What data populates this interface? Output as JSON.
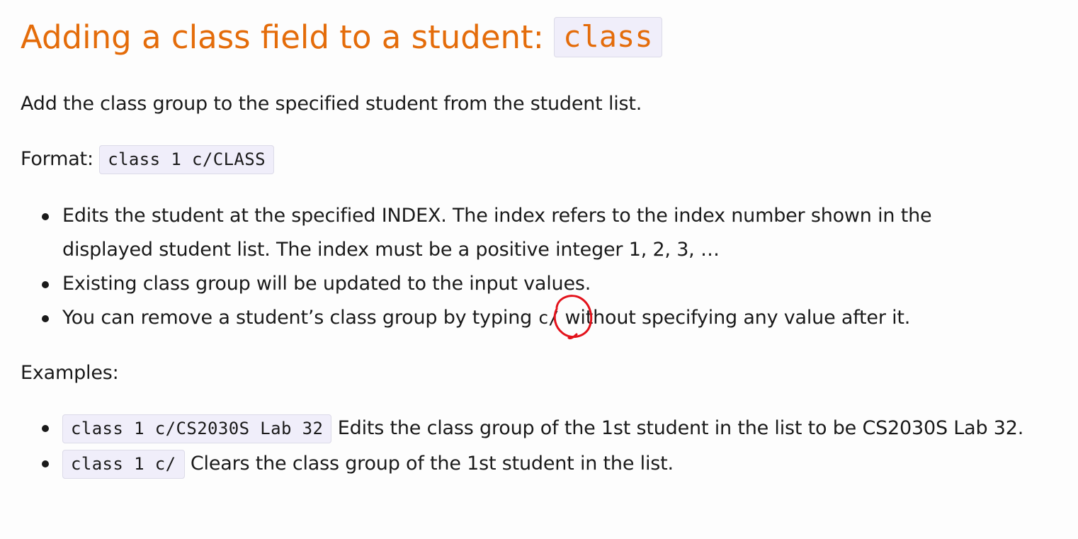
{
  "heading": {
    "text": "Adding a class field to a student: ",
    "code": "class"
  },
  "intro": "Add the class group to the specified student from the student list.",
  "format": {
    "label": "Format: ",
    "code": "class 1 c/CLASS"
  },
  "notes": [
    "Edits the student at the specified INDEX. The index refers to the index number shown in the displayed student list. The index must be a positive integer 1, 2, 3, …",
    "Existing class group will be updated to the input values.",
    {
      "before": "You can remove a student’s class group by typing ",
      "code": "c/",
      "after": " without specifying any value after it."
    }
  ],
  "examples_label": "Examples:",
  "examples": [
    {
      "code": "class 1 c/CS2030S Lab 32",
      "text": " Edits the class group of the 1st student in the list to be CS2030S Lab 32."
    },
    {
      "code": "class 1 c/",
      "text": " Clears the class group of the 1st student in the list."
    }
  ],
  "annotation_color": "#e3121b"
}
